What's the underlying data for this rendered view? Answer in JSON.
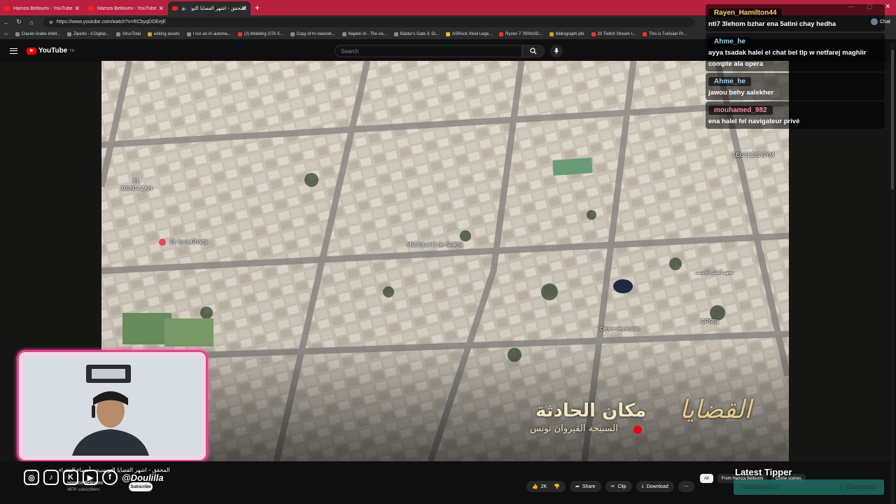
{
  "browser": {
    "tabs": [
      {
        "label": "Hamza Belloumi - YouTube",
        "active": false
      },
      {
        "label": "Hamza Belloumi - YouTube",
        "active": false
      },
      {
        "label": "المحقق - اشهر القضايا التونسية",
        "active": true
      }
    ],
    "new_tab": "+",
    "url": "https://www.youtube.com/watch?v=RCbyqDOEejE",
    "bookmarks": [
      "Clavier Arabe Intell...",
      "Ziperto - A Digital...",
      "VirusTotal",
      "editing assets",
      "I run an AI automa...",
      "(2) Modding GTA S...",
      "Copy of hr-newslet...",
      "Napkin AI - The vis...",
      "Baldur's Gate 3: Di...",
      "ASRock Steel Lege...",
      "Ryzen 7 7800x3D...",
      "bibliographi pfe",
      "20 Twitch Stream I...",
      "This is Tunisian Pr..."
    ],
    "window_controls": [
      "—",
      "▢",
      "✕"
    ]
  },
  "youtube": {
    "logo_text": "YouTube",
    "logo_sup": "TN",
    "search_placeholder": "Search"
  },
  "map": {
    "labels": {
      "el_montazah": "EL\nMONTAZAH",
      "dr_ilyes": "Dr Ilyes Gharbi",
      "municipalite": "Municipalité de Sbikha",
      "centre_impots": "Centre des impôts",
      "cpscl": "CPSCL",
      "legends_gym": "LEGENDS GYM",
      "arabic_small": "معهد الفكر الحديث"
    },
    "overlay_title": "مكان الحادثة",
    "overlay_sub": "السبيخة القيروان تونس",
    "overlay_logo": "القضايا"
  },
  "chat": {
    "messages": [
      {
        "user": "Rayen_Hamilton44",
        "text": "nti7 3lehom bzhar ena 5atini chay hedha",
        "color": "#f0d66a"
      },
      {
        "user": "Ahme_he",
        "text": "ayya tsadak halel el chat bel tlp w netfarej maghiir compte ala opera",
        "color": "#9fd4f5"
      },
      {
        "user": "Ahme_he",
        "text": "jawou behy aalekher",
        "color": "#9fd4f5"
      },
      {
        "user": "mouhamed_982",
        "text": "ena halel fel navigateur privé",
        "color": "#f38aa5"
      }
    ],
    "chat_label": "Chat"
  },
  "bottom": {
    "handle": "@Doulilla",
    "video_title": "المحقق - اشهر القضايا التونسية - أسماء الفقراء",
    "channel": "Hamza Belloumi",
    "subscribers": "487K subscribers",
    "subscribe": "Subscribe",
    "actions": {
      "likes": "2K",
      "share": "Share",
      "clip": "Clip",
      "download": "Download",
      "more": "⋯"
    },
    "chips": [
      "All",
      "From Hamza Belloumi",
      "Crime scenes"
    ],
    "latest_tipper_title": "Latest Tipper",
    "latest_tipper_name": "Nadeeeeeur",
    "latest_tipper_amount": "5 Diamonds"
  }
}
